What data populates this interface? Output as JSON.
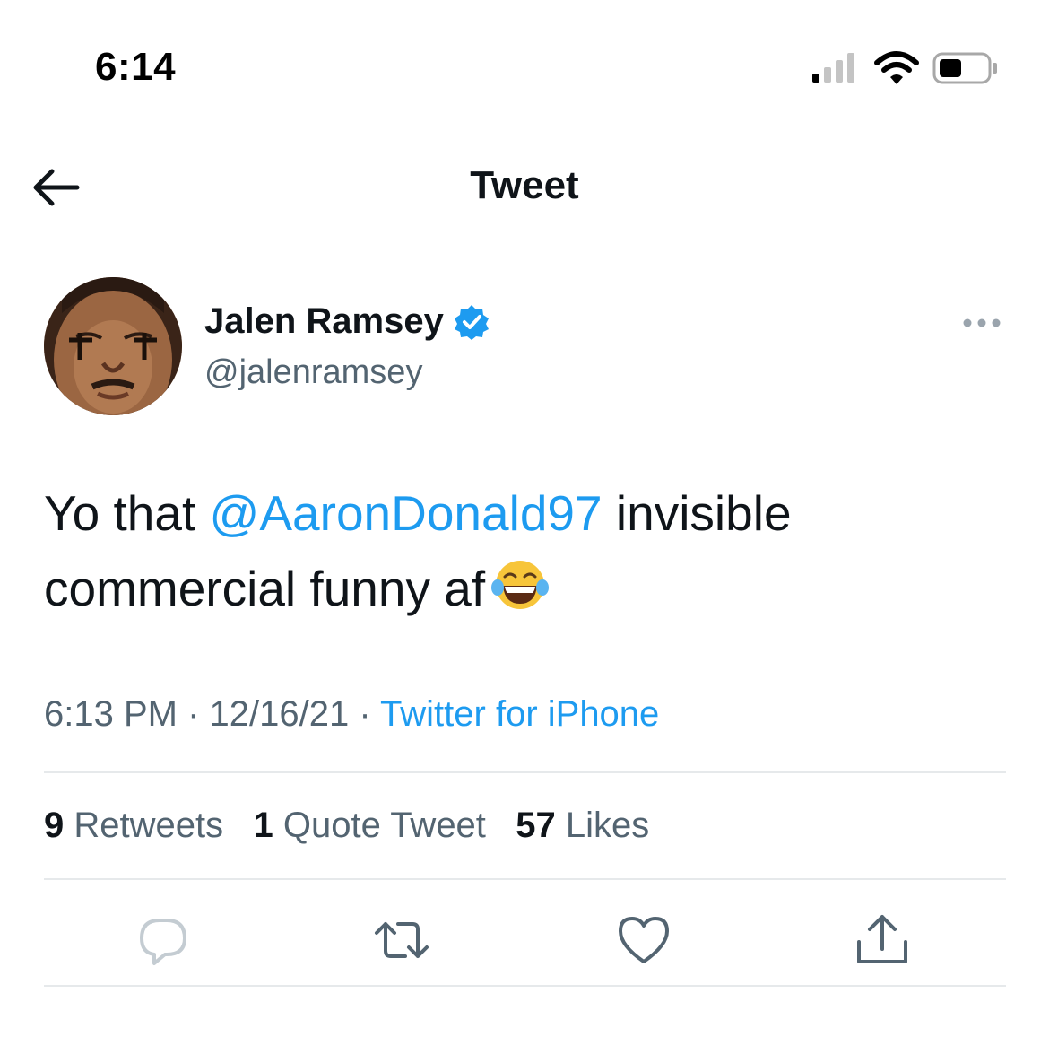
{
  "status_bar": {
    "time": "6:14"
  },
  "header": {
    "title": "Tweet",
    "back_icon": "arrow-left-icon"
  },
  "author": {
    "name": "Jalen Ramsey",
    "handle": "@jalenramsey",
    "verified": true
  },
  "tweet": {
    "text_prefix": "Yo that ",
    "mention": "@AaronDonald97",
    "text_suffix": " invisible commercial funny af",
    "emoji": "face-with-tears-of-joy"
  },
  "meta": {
    "time": "6:13 PM",
    "sep1": " · ",
    "date": "12/16/21",
    "sep2": " · ",
    "source": "Twitter for iPhone"
  },
  "stats": {
    "retweets_count": "9",
    "retweets_label": "Retweets",
    "quotes_count": "1",
    "quotes_label": "Quote Tweet",
    "likes_count": "57",
    "likes_label": "Likes"
  },
  "actions": [
    "reply-icon",
    "retweet-icon",
    "like-icon",
    "share-icon"
  ],
  "colors": {
    "accent": "#1d9bf0",
    "text": "#0f1419",
    "secondary": "#536471",
    "divider": "#e6e9eb"
  }
}
